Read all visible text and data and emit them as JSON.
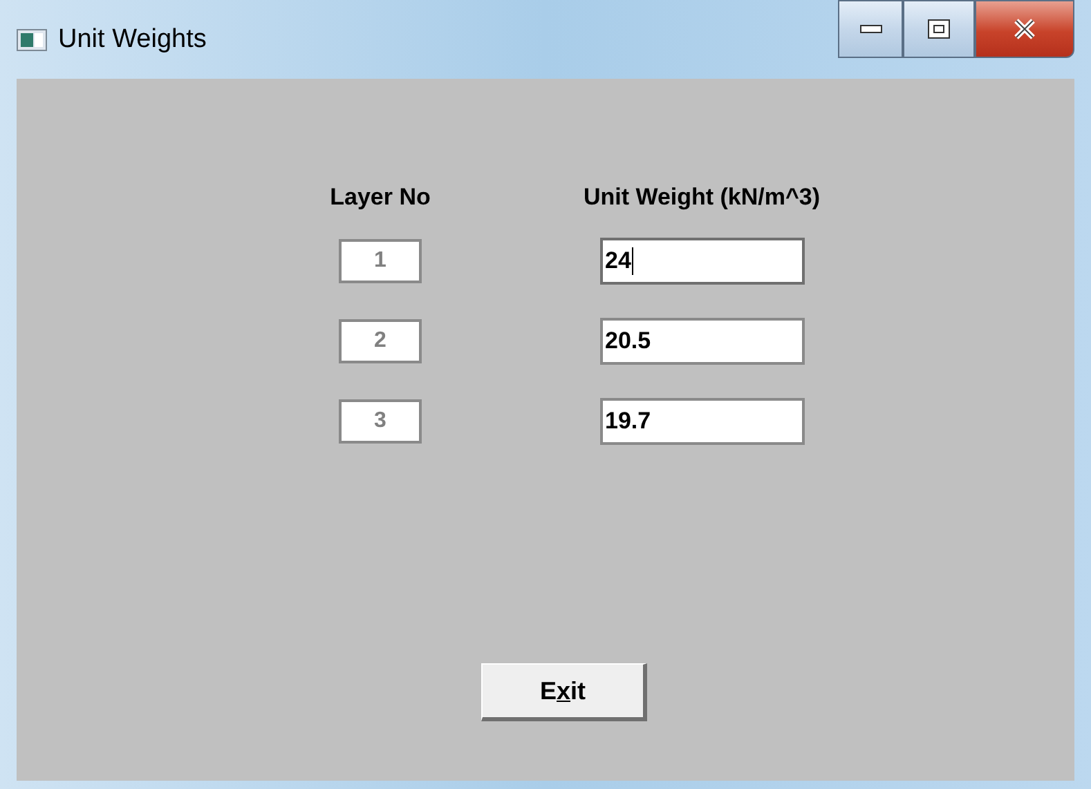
{
  "window": {
    "title": "Unit Weights"
  },
  "columns": [
    "Layer No",
    "Unit Weight (kN/m^3)"
  ],
  "rows": [
    {
      "layer": "1",
      "layer_disabled": true,
      "weight": "24",
      "focused": true
    },
    {
      "layer": "2",
      "layer_disabled": true,
      "weight": "20.5",
      "focused": false
    },
    {
      "layer": "3",
      "layer_disabled": true,
      "weight": "19.7",
      "focused": false
    }
  ],
  "exit_button": {
    "label_before": "E",
    "access_key": "x",
    "label_after": "it"
  }
}
